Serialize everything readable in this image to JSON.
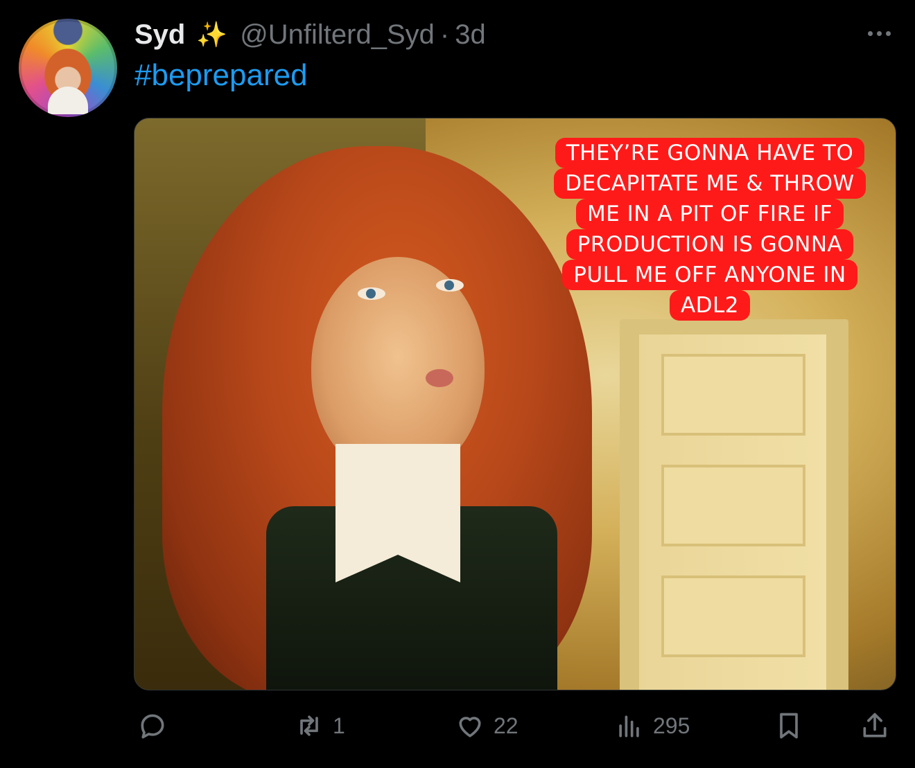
{
  "tweet": {
    "author": {
      "display_name": "Syd",
      "badge_icon": "sparkles-icon",
      "handle": "@Unfilterd_Syd",
      "separator": "·",
      "time": "3d"
    },
    "text": "#beprepared",
    "media": {
      "caption_lines": [
        "THEY’RE GONNA HAVE TO",
        "DECAPITATE ME & THROW",
        "ME IN A PIT OF FIRE IF",
        "PRODUCTION IS GONNA",
        "PULL ME OFF ANYONE IN",
        "ADL2"
      ],
      "caption_bg_color": "#ff1a1a"
    },
    "actions": {
      "reply_count": "",
      "retweet_count": "1",
      "like_count": "22",
      "views_count": "295"
    }
  },
  "colors": {
    "background": "#000000",
    "text_primary": "#e7e9ea",
    "text_secondary": "#71767b",
    "link": "#1d9bf0"
  }
}
